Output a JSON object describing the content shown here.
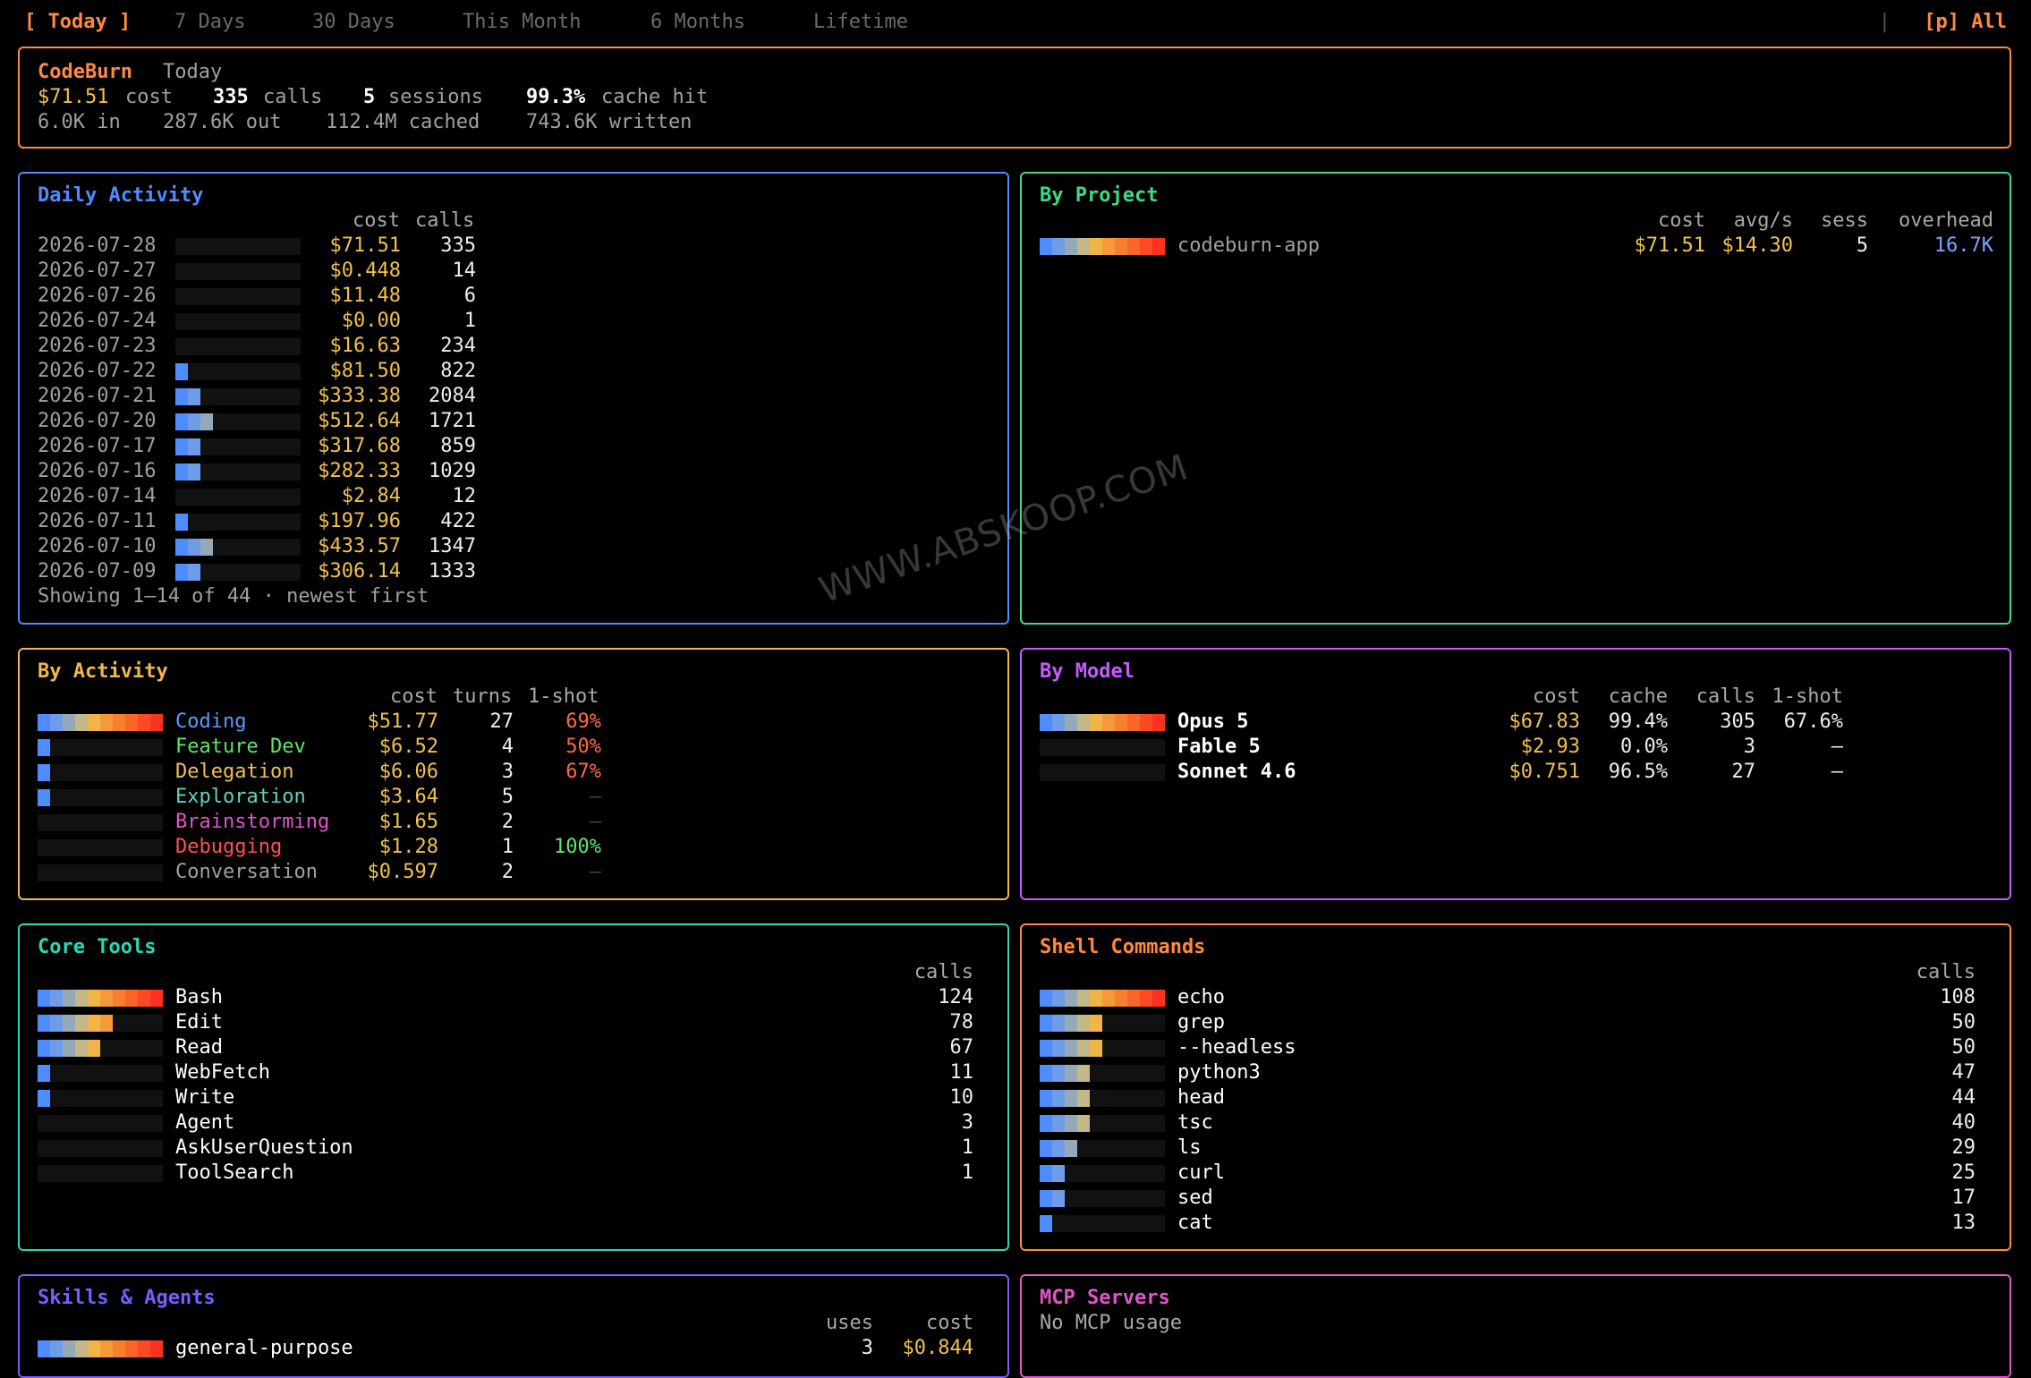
{
  "tabs": {
    "items": [
      "[ Today ]",
      "7 Days",
      "30 Days",
      "This Month",
      "6 Months",
      "Lifetime"
    ],
    "active": 0,
    "separator": "|",
    "provider": "[p] All"
  },
  "summary": {
    "app": "CodeBurn",
    "period": "Today",
    "cost": "$71.51",
    "cost_label": "cost",
    "calls": "335",
    "calls_label": "calls",
    "sessions": "5",
    "sessions_label": "sessions",
    "cache_hit": "99.3%",
    "cache_hit_label": "cache hit",
    "tokens_in": "6.0K in",
    "tokens_out": "287.6K out",
    "tokens_cached": "112.4M cached",
    "tokens_written": "743.6K written"
  },
  "colors": {
    "summary_border": "#ff8a3d",
    "daily_border": "#4f8cff",
    "project_border": "#3ddc84",
    "activity_border": "#f2b84b",
    "model_border": "#c45cff",
    "tools_border": "#2fd6b6",
    "shell_border": "#ff8a3d",
    "skills_border": "#7b5cff",
    "mcp_border": "#e056c8",
    "cost": "#f2c14e",
    "heat": [
      "#4f8cff",
      "#6f9ce8",
      "#96a9b8",
      "#c4b88a",
      "#f0b547",
      "#f59a3a",
      "#f7802e",
      "#fa6528",
      "#fc4b24",
      "#fe3220"
    ]
  },
  "daily": {
    "title": "Daily Activity",
    "columns": [
      "cost",
      "calls"
    ],
    "rows": [
      {
        "date": "2026-07-28",
        "cost": "$71.51",
        "calls": "335",
        "level": 0
      },
      {
        "date": "2026-07-27",
        "cost": "$0.448",
        "calls": "14",
        "level": 0
      },
      {
        "date": "2026-07-26",
        "cost": "$11.48",
        "calls": "6",
        "level": 0
      },
      {
        "date": "2026-07-24",
        "cost": "$0.00",
        "calls": "1",
        "level": 0
      },
      {
        "date": "2026-07-23",
        "cost": "$16.63",
        "calls": "234",
        "level": 0
      },
      {
        "date": "2026-07-22",
        "cost": "$81.50",
        "calls": "822",
        "level": 1
      },
      {
        "date": "2026-07-21",
        "cost": "$333.38",
        "calls": "2084",
        "level": 2
      },
      {
        "date": "2026-07-20",
        "cost": "$512.64",
        "calls": "1721",
        "level": 3
      },
      {
        "date": "2026-07-17",
        "cost": "$317.68",
        "calls": "859",
        "level": 2
      },
      {
        "date": "2026-07-16",
        "cost": "$282.33",
        "calls": "1029",
        "level": 2
      },
      {
        "date": "2026-07-14",
        "cost": "$2.84",
        "calls": "12",
        "level": 0
      },
      {
        "date": "2026-07-11",
        "cost": "$197.96",
        "calls": "422",
        "level": 1
      },
      {
        "date": "2026-07-10",
        "cost": "$433.57",
        "calls": "1347",
        "level": 3
      },
      {
        "date": "2026-07-09",
        "cost": "$306.14",
        "calls": "1333",
        "level": 2
      }
    ],
    "footer": "Showing 1–14 of 44 · newest first"
  },
  "project": {
    "title": "By Project",
    "columns": [
      "cost",
      "avg/s",
      "sess",
      "overhead"
    ],
    "rows": [
      {
        "name": "codeburn-app",
        "cost": "$71.51",
        "avg": "$14.30",
        "sess": "5",
        "overhead": "16.7K",
        "level": 10
      }
    ]
  },
  "activity": {
    "title": "By Activity",
    "columns": [
      "cost",
      "turns",
      "1-shot"
    ],
    "rows": [
      {
        "name": "Coding",
        "color": "#5b9cff",
        "cost": "$51.77",
        "turns": "27",
        "oneshot": "69%",
        "oneshot_color": "#ff6a3d",
        "level": 10
      },
      {
        "name": "Feature Dev",
        "color": "#5ee86a",
        "cost": "$6.52",
        "turns": "4",
        "oneshot": "50%",
        "oneshot_color": "#ff6a3d",
        "level": 1
      },
      {
        "name": "Delegation",
        "color": "#f2c14e",
        "cost": "$6.06",
        "turns": "3",
        "oneshot": "67%",
        "oneshot_color": "#ff6a3d",
        "level": 1
      },
      {
        "name": "Exploration",
        "color": "#5fd3c0",
        "cost": "$3.64",
        "turns": "5",
        "oneshot": "—",
        "oneshot_color": "#444444",
        "level": 1
      },
      {
        "name": "Brainstorming",
        "color": "#e056c8",
        "cost": "$1.65",
        "turns": "2",
        "oneshot": "—",
        "oneshot_color": "#444444",
        "level": 0
      },
      {
        "name": "Debugging",
        "color": "#ff5050",
        "cost": "$1.28",
        "turns": "1",
        "oneshot": "100%",
        "oneshot_color": "#5ee86a",
        "level": 0
      },
      {
        "name": "Conversation",
        "color": "#a0a0a0",
        "cost": "$0.597",
        "turns": "2",
        "oneshot": "—",
        "oneshot_color": "#444444",
        "level": 0
      }
    ]
  },
  "model": {
    "title": "By Model",
    "columns": [
      "cost",
      "cache",
      "calls",
      "1-shot"
    ],
    "rows": [
      {
        "name": "Opus 5",
        "cost": "$67.83",
        "cache": "99.4%",
        "calls": "305",
        "oneshot": "67.6%",
        "level": 10
      },
      {
        "name": "Fable 5",
        "cost": "$2.93",
        "cache": "0.0%",
        "calls": "3",
        "oneshot": "–",
        "level": 0
      },
      {
        "name": "Sonnet 4.6",
        "cost": "$0.751",
        "cache": "96.5%",
        "calls": "27",
        "oneshot": "–",
        "level": 0
      }
    ]
  },
  "tools": {
    "title": "Core Tools",
    "columns": [
      "calls"
    ],
    "rows": [
      {
        "name": "Bash",
        "calls": "124",
        "level": 10
      },
      {
        "name": "Edit",
        "calls": "78",
        "level": 6
      },
      {
        "name": "Read",
        "calls": "67",
        "level": 5
      },
      {
        "name": "WebFetch",
        "calls": "11",
        "level": 1
      },
      {
        "name": "Write",
        "calls": "10",
        "level": 1
      },
      {
        "name": "Agent",
        "calls": "3",
        "level": 0
      },
      {
        "name": "AskUserQuestion",
        "calls": "1",
        "level": 0
      },
      {
        "name": "ToolSearch",
        "calls": "1",
        "level": 0
      }
    ]
  },
  "shell": {
    "title": "Shell Commands",
    "columns": [
      "calls"
    ],
    "rows": [
      {
        "name": "echo",
        "calls": "108",
        "level": 10
      },
      {
        "name": "grep",
        "calls": "50",
        "level": 5
      },
      {
        "name": "--headless",
        "calls": "50",
        "level": 5
      },
      {
        "name": "python3",
        "calls": "47",
        "level": 4
      },
      {
        "name": "head",
        "calls": "44",
        "level": 4
      },
      {
        "name": "tsc",
        "calls": "40",
        "level": 4
      },
      {
        "name": "ls",
        "calls": "29",
        "level": 3
      },
      {
        "name": "curl",
        "calls": "25",
        "level": 2
      },
      {
        "name": "sed",
        "calls": "17",
        "level": 2
      },
      {
        "name": "cat",
        "calls": "13",
        "level": 1
      }
    ]
  },
  "skills": {
    "title": "Skills & Agents",
    "columns": [
      "uses",
      "cost"
    ],
    "rows": [
      {
        "name": "general-purpose",
        "uses": "3",
        "cost": "$0.844",
        "level": 10
      }
    ]
  },
  "mcp": {
    "title": "MCP Servers",
    "empty": "No MCP usage"
  },
  "watermark": "WWW.ABSKOOP.COM"
}
